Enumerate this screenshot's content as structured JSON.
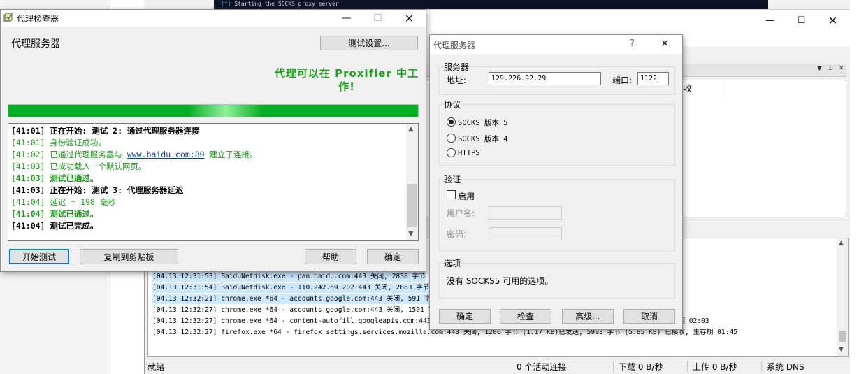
{
  "terminal": {
    "prefix": "[*]",
    "text": "Starting the SOCKS proxy server"
  },
  "main_window": {
    "column_header_partial": "收",
    "log_lines": [
      {
        "text": "[04.13 12:31:53] BaiduNetdisk.exe - pan.baidu.com:443 关闭, 2838 字节",
        "highlight": true
      },
      {
        "text": "[04.13 12:31:54] BaiduNetdisk.exe - 110.242.69.202:443 关闭, 2883 字节 (2.81 KB)已发送, 6057 字节 (5.91 KB) 已接收, 生存期 00:57",
        "highlight": true
      },
      {
        "text": "[04.13 12:32:21] chrome.exe *64 - accounts.google.com:443 关闭, 591 字节",
        "highlight": true
      },
      {
        "text": "[04.13 12:32:27] chrome.exe *64 - accounts.google.com:443 关闭, 1501 字节 (1.46 KB)已发送, 7079 字节 (6.91 KB) 已接收, 生存期 02:00",
        "highlight": false
      },
      {
        "text": "[04.13 12:32:27] chrome.exe *64 - content-autofill.googleapis.com:443 关闭, 1876 字节 (1.83 KB)已发送, 5966 字节 (5.82 KB) 已接收, 生存期 02:03",
        "highlight": false
      },
      {
        "text": "[04.13 12:32:27] firefox.exe *64 - firefox.settings.services.mozilla.com:443 关闭, 1206 字节 (1.17 KB)已发送, 5993 字节 (5.85 KB) 已接收, 生存期 01:45",
        "highlight": false
      }
    ],
    "status": {
      "state": "就绪",
      "connections": "0 个活动连接",
      "download": "下载 0 B/秒",
      "upload": "上传 0 B/秒",
      "dns": "系统 DNS"
    }
  },
  "checker": {
    "title": "代理检查器",
    "server_label": "代理服务器",
    "test_settings_button": "测试设置...",
    "message": "代理可以在 Proxifier 中工作!",
    "progress_percent": 100,
    "progress_color": "#06b025",
    "success_color": "#1ea21e",
    "log_lines": [
      {
        "text": "[41:01] 正在开始: 测试 2: 通过代理服务器连接",
        "style": "b"
      },
      {
        "text": "[41:01] 身份验证成功。",
        "style": "g"
      },
      {
        "pre": "[41:02] 已通过代理服务器与 ",
        "link": "www.baidu.com:80",
        "post": " 建立了连接。",
        "style": "g"
      },
      {
        "text": "[41:03] 已成功载入一个默认网页。",
        "style": "g"
      },
      {
        "text": "[41:03] 测试已通过。",
        "style": "gb"
      },
      {
        "text": "[41:03] 正在开始: 测试 3: 代理服务器延迟",
        "style": "b"
      },
      {
        "text": "[41:04] 延迟 = 198 毫秒",
        "style": "g"
      },
      {
        "text": "[41:04] 测试已通过。",
        "style": "gb"
      },
      {
        "text": "[41:04] 测试已完成。",
        "style": "b"
      }
    ],
    "buttons": {
      "start": "开始测试",
      "copy": "复制到剪贴板",
      "help": "帮助",
      "ok": "确定"
    }
  },
  "proxy_dialog": {
    "title": "代理服务器",
    "help_glyph": "?",
    "server_group": "服务器",
    "address_label": "地址:",
    "address_value": "129.226.92.29",
    "port_label": "端口:",
    "port_value": "1122",
    "protocol_group": "协议",
    "protocols": [
      {
        "label": "SOCKS 版本 5",
        "selected": true
      },
      {
        "label": "SOCKS 版本 4",
        "selected": false
      },
      {
        "label": "HTTPS",
        "selected": false
      }
    ],
    "auth_group": "验证",
    "enable_label": "启用",
    "auth_enabled": false,
    "username_label": "用户名:",
    "password_label": "密码:",
    "options_group": "选项",
    "options_text": "没有 SOCKS5 可用的选项。",
    "buttons": {
      "ok": "确定",
      "check": "检查",
      "advanced": "高级...",
      "cancel": "取消"
    }
  }
}
